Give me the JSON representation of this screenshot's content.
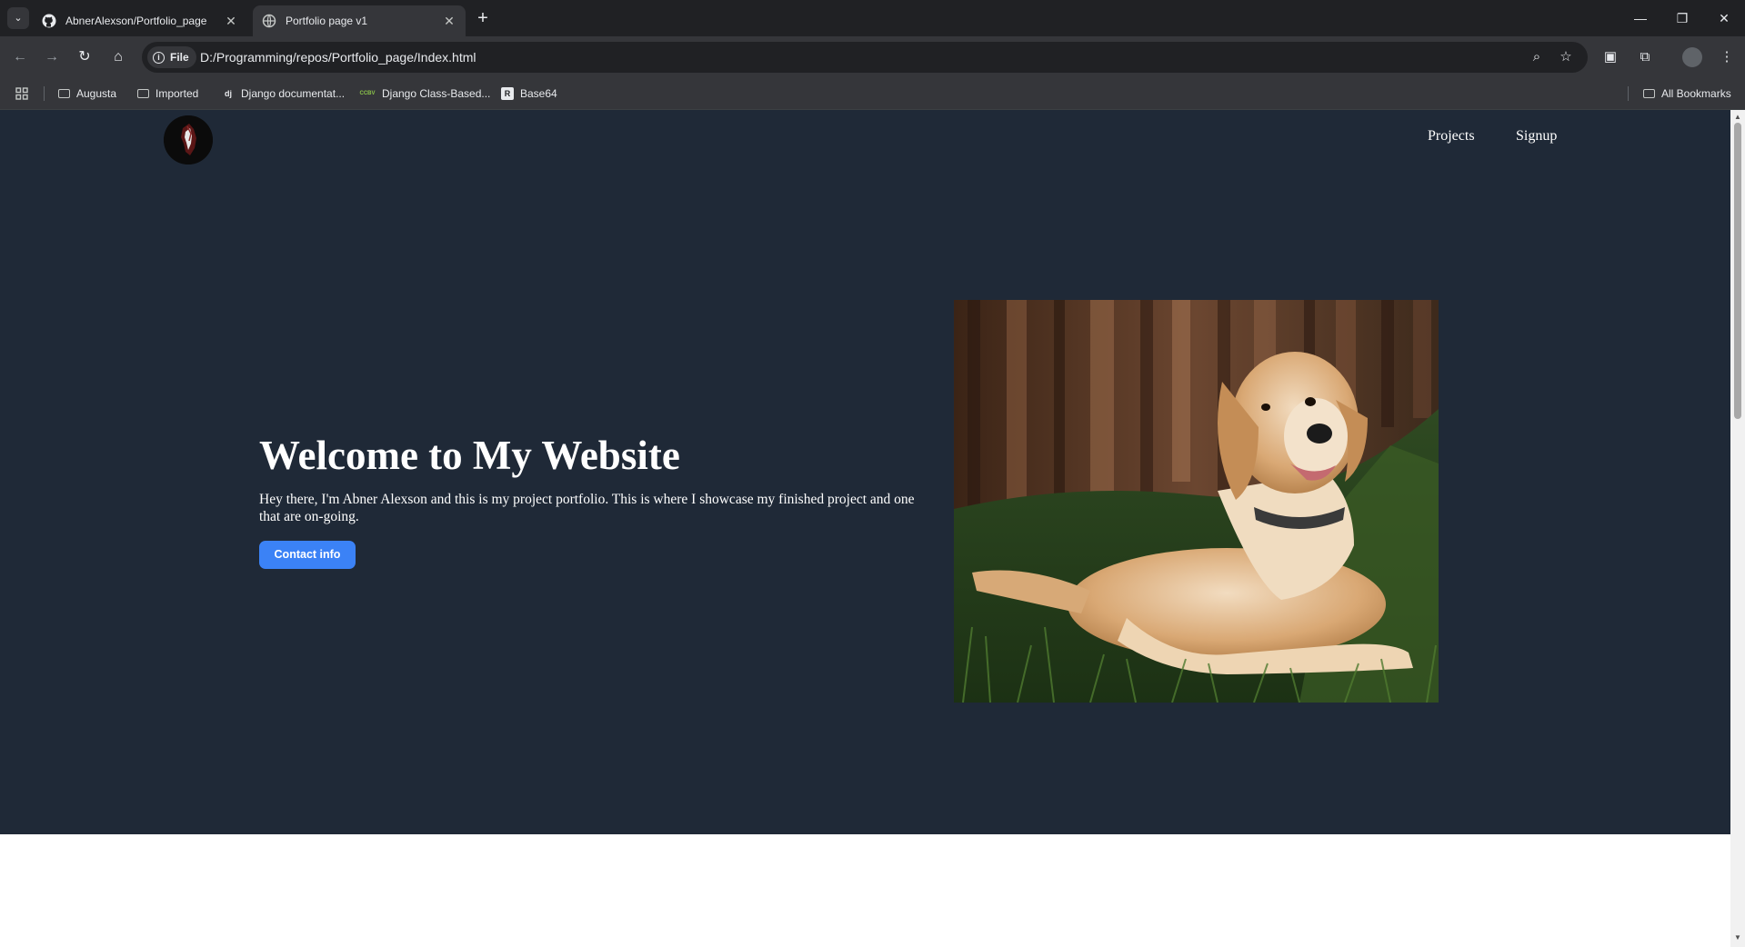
{
  "browser": {
    "tabs": [
      {
        "title": "AbnerAlexson/Portfolio_page",
        "favicon": "github-icon",
        "active": false
      },
      {
        "title": "Portfolio page v1",
        "favicon": "globe-icon",
        "active": true
      }
    ],
    "chip_label": "File",
    "url": "D:/Programming/repos/Portfolio_page/Index.html",
    "bookmarks": [
      {
        "label": "Augusta",
        "icon": "folder-icon"
      },
      {
        "label": "Imported",
        "icon": "folder-icon"
      },
      {
        "label": "Django documentat...",
        "icon": "django-icon",
        "badge": "dj"
      },
      {
        "label": "Django Class-Based...",
        "icon": "ccbv-icon",
        "badge": "CCBV"
      },
      {
        "label": "Base64",
        "icon": "base64-icon",
        "badge": "R"
      }
    ],
    "all_bookmarks": "All Bookmarks"
  },
  "site": {
    "nav": {
      "projects": "Projects",
      "signup": "Signup"
    },
    "hero": {
      "title": "Welcome to My Website",
      "text": "Hey there, I'm Abner Alexson and this is my project portfolio. This is where I showcase my finished project and one that are on-going.",
      "button": "Contact info"
    },
    "colors": {
      "hero_bg": "#1f2937",
      "button": "#3b82f6"
    }
  }
}
